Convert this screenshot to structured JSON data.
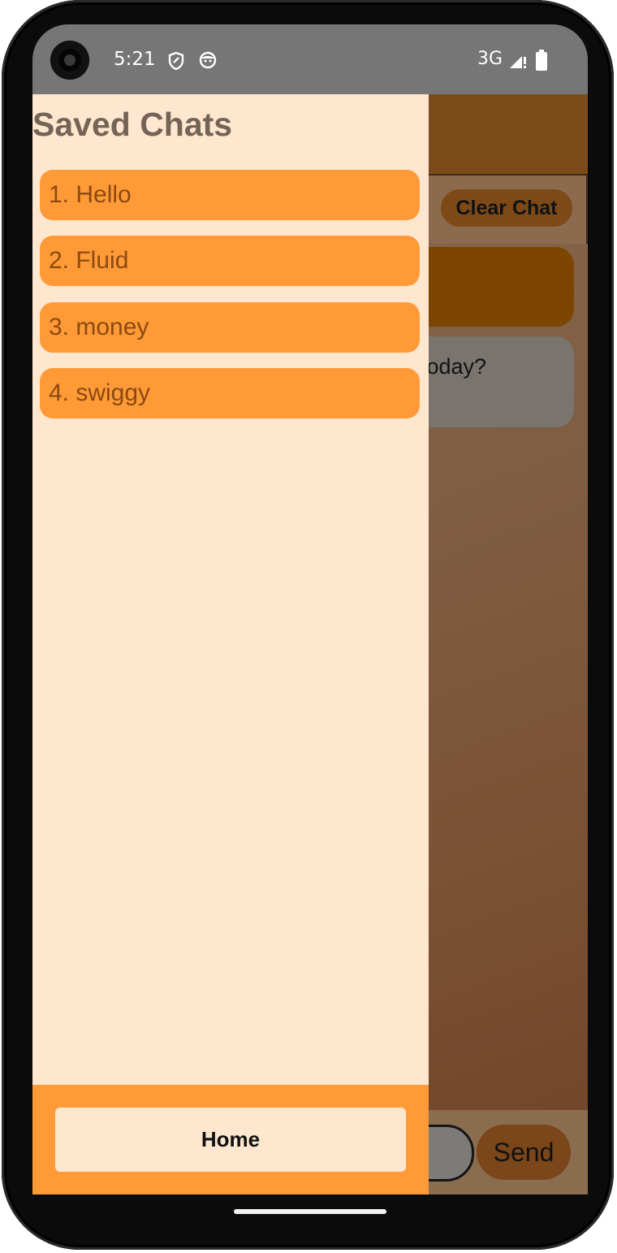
{
  "status_bar": {
    "time": "5:21",
    "network": "3G",
    "icons": [
      "shield-icon",
      "face-icon",
      "signal-icon",
      "battery-icon"
    ]
  },
  "background_app": {
    "clear_chat_label": "Clear Chat",
    "bot_message_visible_text": "today?",
    "send_label": "Send"
  },
  "drawer": {
    "title": "Saved Chats",
    "items": [
      {
        "label": "1. Hello"
      },
      {
        "label": "2. Fluid"
      },
      {
        "label": "3. money"
      },
      {
        "label": "4. swiggy"
      }
    ],
    "home_label": "Home"
  },
  "colors": {
    "drawer_bg": "#ffe7cf",
    "accent_orange": "#ff9a36",
    "item_text": "#8a4a12",
    "title_text": "#746457"
  }
}
